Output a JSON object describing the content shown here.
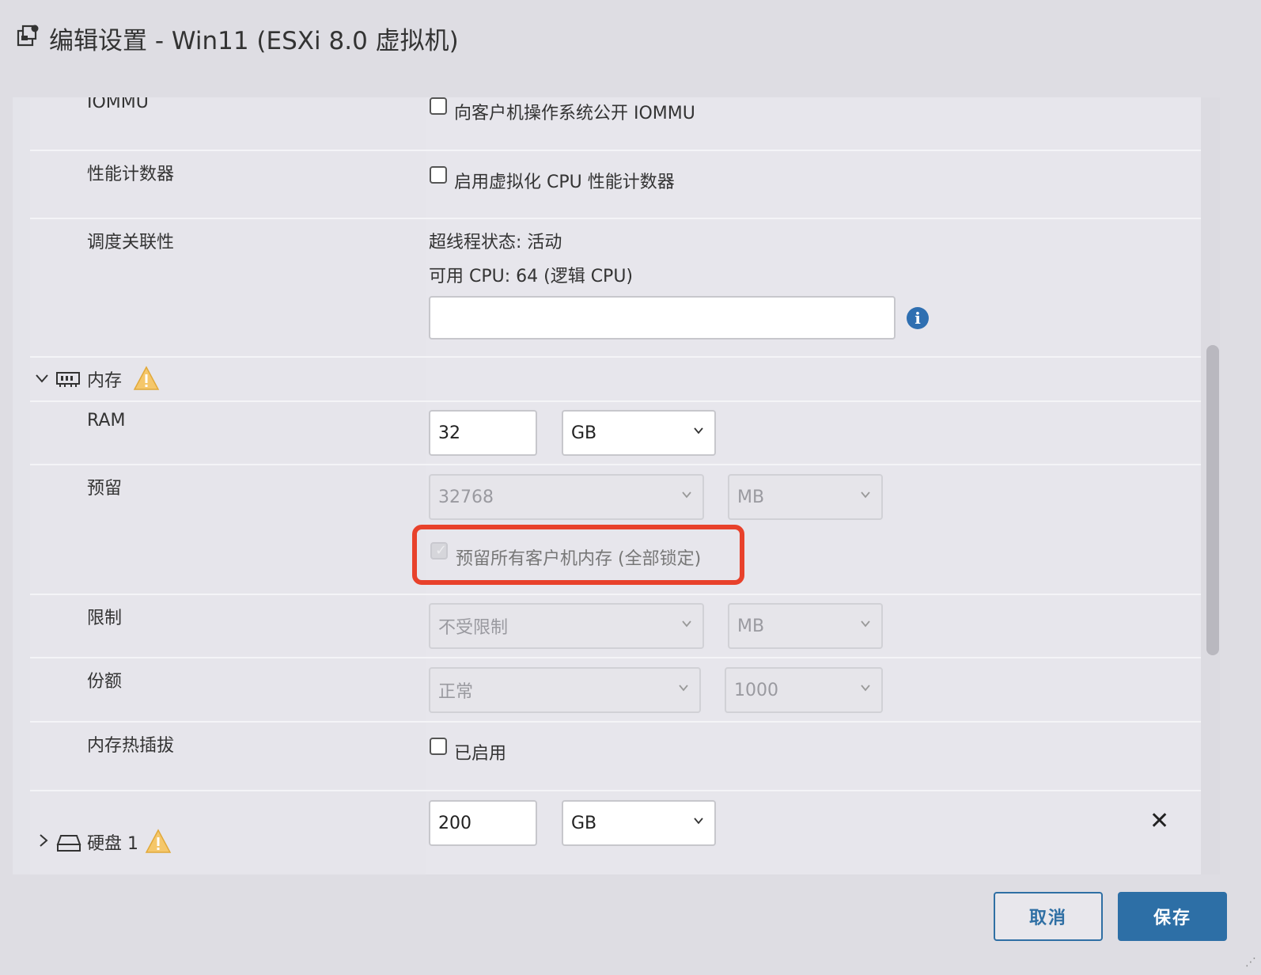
{
  "window": {
    "title": "编辑设置 - Win11 (ESXi 8.0 虚拟机)"
  },
  "rows": {
    "iommu": {
      "label": "IOMMU",
      "checkbox_label": "向客户机操作系统公开 IOMMU",
      "checked": false
    },
    "perf_counters": {
      "label": "性能计数器",
      "checkbox_label": "启用虚拟化 CPU 性能计数器",
      "checked": false
    },
    "scheduling_affinity": {
      "label": "调度关联性",
      "hyperthreading_status": "超线程状态: 活动",
      "available_cpu": "可用 CPU: 64 (逻辑 CPU)",
      "input_value": ""
    },
    "memory_section": {
      "label": "内存",
      "expanded": true
    },
    "ram": {
      "label": "RAM",
      "value": "32",
      "unit": "GB"
    },
    "reservation": {
      "label": "预留",
      "value": "32768",
      "unit": "MB",
      "lock_all_label": "预留所有客户机内存 (全部锁定)",
      "lock_all_checked": true
    },
    "limit": {
      "label": "限制",
      "value": "不受限制",
      "unit": "MB"
    },
    "shares": {
      "label": "份额",
      "level": "正常",
      "value": "1000"
    },
    "memory_hot_plug": {
      "label": "内存热插拔",
      "checkbox_label": "已启用",
      "checked": false
    },
    "hard_disk_1": {
      "label": "硬盘 1",
      "value": "200",
      "unit": "GB",
      "expanded": false
    }
  },
  "footer": {
    "cancel_label": "取消",
    "save_label": "保存"
  },
  "colors": {
    "primary": "#2d6fa6",
    "highlight": "#e8412b",
    "warning": "#f5c542",
    "info": "#2f6fb1"
  }
}
